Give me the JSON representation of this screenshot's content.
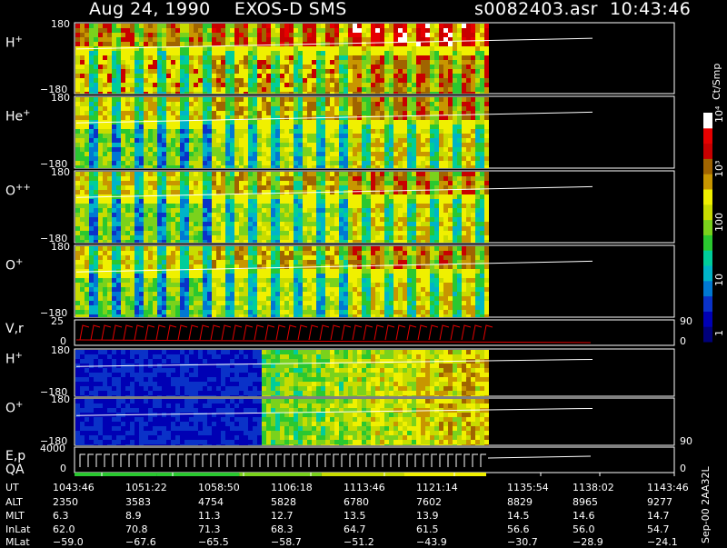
{
  "header": {
    "date": "Aug 24, 1990",
    "mission": "EXOS-D SMS",
    "file": "s0082403.asr",
    "time": "10:43:46"
  },
  "colorbar": {
    "unit": "Ct/Smp",
    "ticks": [
      "1",
      "10",
      "100",
      "10³",
      "10⁴"
    ],
    "colors": [
      "#00007a",
      "#0000b4",
      "#0a32c8",
      "#0078d2",
      "#00b4c8",
      "#00cd9b",
      "#2ac830",
      "#7ad21c",
      "#c8dc00",
      "#f0f000",
      "#c89600",
      "#a06400",
      "#c80000",
      "#e60000",
      "#ffffff"
    ]
  },
  "panels": [
    {
      "label": "H",
      "sup": "+",
      "top": "180",
      "bottom": "−180"
    },
    {
      "label": "He",
      "sup": "+",
      "top": "180",
      "bottom": "−180"
    },
    {
      "label": "O",
      "sup": "++",
      "top": "180",
      "bottom": "−180"
    },
    {
      "label": "O",
      "sup": "+",
      "top": "180",
      "bottom": "−180"
    },
    {
      "label": "V,r",
      "sup": "",
      "top": "25",
      "bottom": "0",
      "right_top": "90",
      "right_bottom": "0"
    },
    {
      "label": "H",
      "sup": "+",
      "top": "180",
      "bottom": "−180"
    },
    {
      "label": "O",
      "sup": "+",
      "top": "180",
      "bottom": "−180",
      "right_bottom": "90"
    },
    {
      "label": "E,p",
      "sup": "",
      "top": "4000",
      "bottom": "0",
      "right_bottom": "0"
    }
  ],
  "qa_label": "QA",
  "side_id": "Sep-00  2AA32L",
  "table": {
    "row_labels": [
      "UT",
      "ALT",
      "MLT",
      "InLat",
      "MLat"
    ],
    "columns": [
      [
        "1043:46",
        "2350",
        "6.3",
        "62.0",
        "−59.0"
      ],
      [
        "1051:22",
        "3583",
        "8.9",
        "70.8",
        "−67.6"
      ],
      [
        "1058:50",
        "4754",
        "11.3",
        "71.3",
        "−65.5"
      ],
      [
        "1106:18",
        "5828",
        "12.7",
        "68.3",
        "−58.7"
      ],
      [
        "1113:46",
        "6780",
        "13.5",
        "64.7",
        "−51.2"
      ],
      [
        "1121:14",
        "7602",
        "13.9",
        "61.5",
        "−43.9"
      ],
      [
        "1135:54",
        "8829",
        "14.5",
        "56.6",
        "−30.7"
      ],
      [
        "1138:02",
        "8965",
        "14.6",
        "56.0",
        "−28.9"
      ],
      [
        "1143:46",
        "9277",
        "14.7",
        "54.7",
        "−24.1"
      ]
    ]
  },
  "chart_data": {
    "type": "heatmap",
    "title": "Aug 24, 1990   EXOS-D SMS",
    "x_ticks": [
      "1043:46",
      "1051:22",
      "1058:50",
      "1106:18",
      "1113:46",
      "1121:14",
      "1135:54",
      "1138:02",
      "1143:46"
    ],
    "color_scale": "log",
    "color_range": [
      1,
      10000
    ],
    "color_label": "Ct/Smp",
    "series": [
      {
        "name": "H+",
        "ylim": [
          -180,
          180
        ]
      },
      {
        "name": "He+",
        "ylim": [
          -180,
          180
        ]
      },
      {
        "name": "O++",
        "ylim": [
          -180,
          180
        ]
      },
      {
        "name": "O+",
        "ylim": [
          -180,
          180
        ]
      },
      {
        "name": "V,r",
        "ylim": [
          0,
          25
        ],
        "y2lim": [
          0,
          90
        ]
      },
      {
        "name": "H+",
        "ylim": [
          -180,
          180
        ]
      },
      {
        "name": "O+",
        "ylim": [
          -180,
          180
        ]
      },
      {
        "name": "E,p",
        "ylim": [
          0,
          4000
        ],
        "y2lim": [
          0,
          90
        ]
      }
    ]
  }
}
